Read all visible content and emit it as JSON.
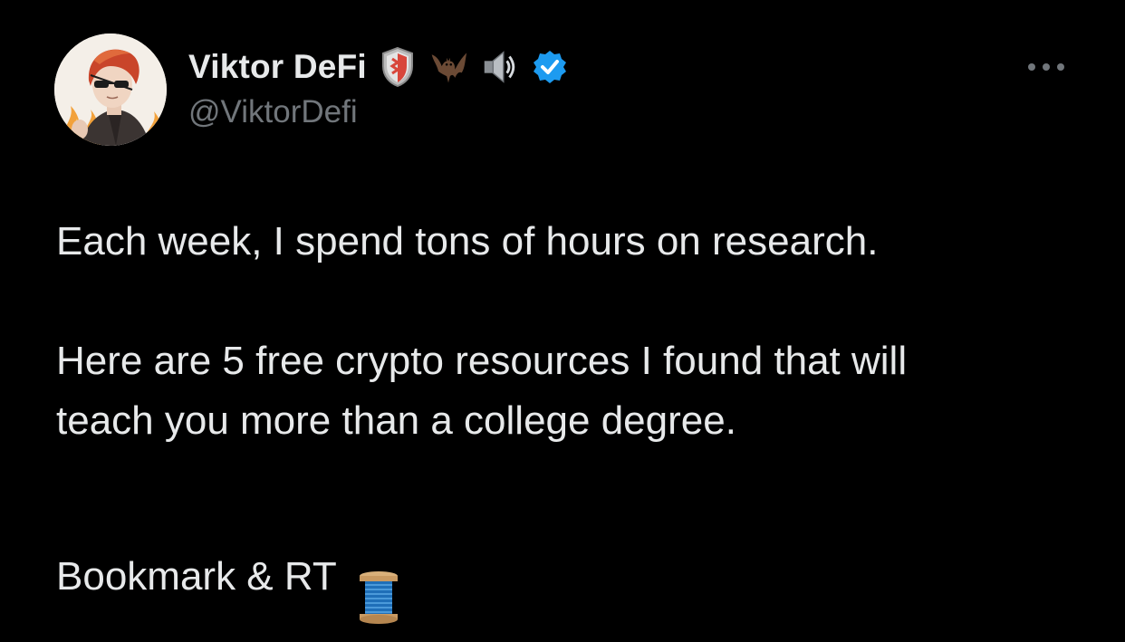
{
  "author": {
    "display_name": "Viktor DeFi",
    "handle": "@ViktorDefi",
    "badges": [
      "shield-emoji-icon",
      "bat-emoji-icon",
      "speaker-emoji-icon",
      "verified-badge-icon"
    ],
    "verified_color": "#1d9bf0"
  },
  "tweet": {
    "paragraphs": [
      "Each week, I spend tons of hours on research.",
      "Here are 5 free crypto resources I found that will\nteach you more than a college degree.",
      "Bookmark & RT"
    ],
    "trailing_emoji": "thread-spool-icon"
  },
  "menu": {
    "icon": "more-options-icon"
  },
  "colors": {
    "background": "#000000",
    "text": "#e7e9ea",
    "secondary": "#71767b"
  }
}
